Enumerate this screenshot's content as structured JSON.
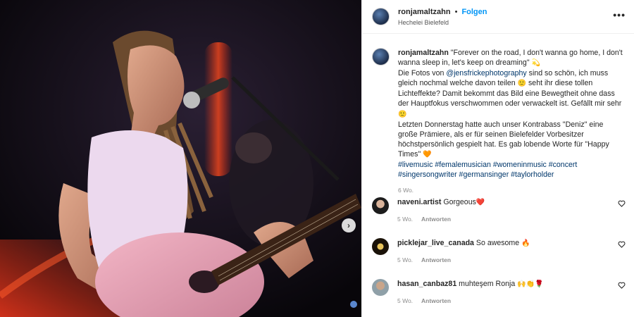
{
  "post": {
    "username": "ronjamaltzahn",
    "follow_label": "Folgen",
    "separator": "•",
    "location": "Hechelei Bielefeld",
    "more_label": "•••"
  },
  "caption": {
    "username": "ronjamaltzahn",
    "text1": " \"Forever on the road, I don't wanna go home, I don't wanna sleep in, let's keep on dreaming\" ",
    "emoji1": "💫",
    "text2": "Die Fotos von ",
    "mention": "@jensfrickephotography",
    "text3": " sind so schön, ich muss gleich nochmal welche davon teilen ",
    "emoji2": "🙂",
    "text4": " seht ihr diese tollen Lichteffekte? Damit bekommt das Bild eine Bewegtheit ohne dass der Hauptfokus verschwommen oder verwackelt ist. Gefällt mir sehr ",
    "emoji3": "🙂",
    "text5": "Letzten Donnerstag hatte auch unser Kontrabass \"Deniz\" eine große Prämiere, als er für seinen Bielefelder Vorbesitzer höchstpersönlich gespielt hat. Es gab lobende Worte für \"Happy Times\" ",
    "emoji4": "🧡",
    "hashtags": "#livemusic #femalemusician #womeninmusic #concert #singersongwriter #germansinger #taylorholder",
    "time": "6 Wo."
  },
  "comments": [
    {
      "username": "naveni.artist",
      "text": " Gorgeous",
      "emoji": "❤️",
      "time": "5 Wo.",
      "reply": "Antworten"
    },
    {
      "username": "picklejar_live_canada",
      "text": " So awesome ",
      "emoji": "🔥",
      "time": "5 Wo.",
      "reply": "Antworten"
    },
    {
      "username": "hasan_canbaz81",
      "text": " muhteşem Ronja ",
      "emoji": "🙌👏🌹",
      "time": "5 Wo.",
      "reply": "Antworten"
    }
  ],
  "colors": {
    "link": "#00376b",
    "follow": "#0095f6",
    "heart": "#ed4956",
    "muted": "#8e8e8e"
  },
  "icons": {
    "next": "chevron-right-icon",
    "like": "heart-outline-icon"
  }
}
